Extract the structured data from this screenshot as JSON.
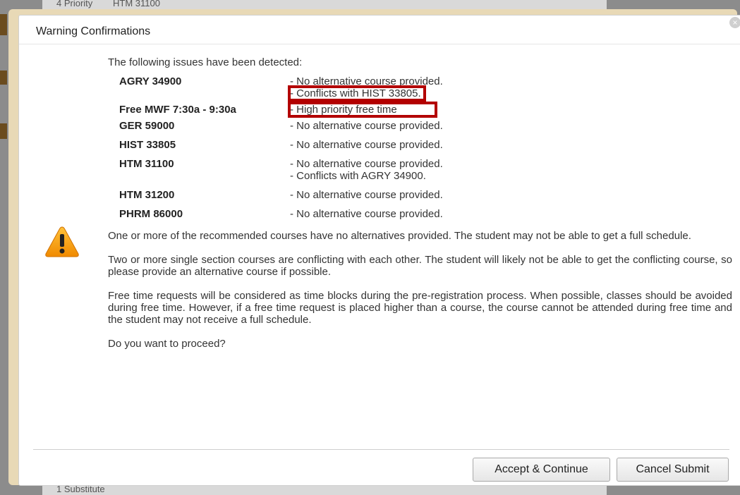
{
  "background": {
    "top_label": "4 Priority",
    "top_course": "HTM 31100",
    "bottom_label": "1 Substitute"
  },
  "dialog": {
    "title": "Warning Confirmations",
    "close_glyph": "×",
    "intro": "The following issues have been detected:",
    "issues": [
      {
        "code": "AGRY 34900",
        "messages": [
          "- No alternative course provided.",
          "- Conflicts with HIST 33805."
        ]
      },
      {
        "code": "Free MWF 7:30a - 9:30a",
        "messages": [
          "- High priority free time"
        ]
      },
      {
        "code": "GER 59000",
        "messages": [
          "- No alternative course provided."
        ]
      },
      {
        "code": "HIST 33805",
        "messages": [
          "- No alternative course provided."
        ]
      },
      {
        "code": "HTM 31100",
        "messages": [
          "- No alternative course provided.",
          "- Conflicts with AGRY 34900."
        ]
      },
      {
        "code": "HTM 31200",
        "messages": [
          "- No alternative course provided."
        ]
      },
      {
        "code": "PHRM 86000",
        "messages": [
          "- No alternative course provided."
        ]
      }
    ],
    "paragraphs": [
      "One or more of the recommended courses have no alternatives provided. The student may not be able to get a full schedule.",
      "Two or more single section courses are conflicting with each other. The student will likely not be able to get the conflicting course, so please provide an alternative course if possible.",
      "Free time requests will be considered as time blocks during the pre-registration process. When possible, classes should be avoided during free time. However, if a free time request is placed higher than a course, the course cannot be attended during free time and the student may not receive a full schedule.",
      "Do you want to proceed?"
    ],
    "accept_label": "Accept & Continue",
    "cancel_label": "Cancel Submit",
    "icon": "warning-triangle-icon",
    "highlight_color": "#b30000"
  }
}
